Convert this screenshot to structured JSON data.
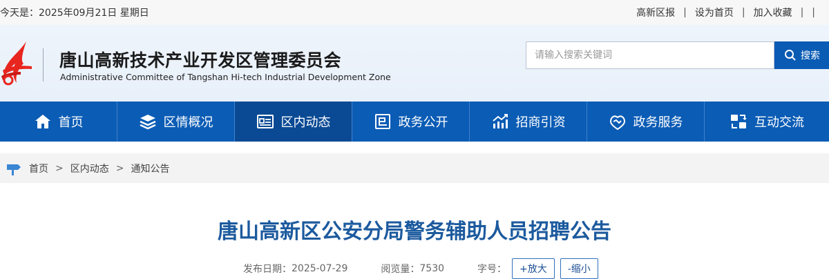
{
  "topbar": {
    "date_label": "今天是：",
    "date_value": "2025年09月21日 星期日",
    "links": [
      "高新区报",
      "设为首页",
      "加入收藏"
    ]
  },
  "header": {
    "title_cn": "唐山高新技术产业开发区管理委员会",
    "title_en": "Administrative Committee of Tangshan Hi-tech Industrial Development Zone",
    "search_placeholder": "请输入搜索关键词",
    "search_button": "搜索",
    "logo_colors": [
      "#e8251e",
      "#f39c12"
    ]
  },
  "nav": {
    "items": [
      {
        "label": "首页",
        "icon": "home-icon"
      },
      {
        "label": "区情概况",
        "icon": "layers-icon"
      },
      {
        "label": "区内动态",
        "icon": "news-icon",
        "active": true
      },
      {
        "label": "政务公开",
        "icon": "document-icon"
      },
      {
        "label": "招商引资",
        "icon": "chart-icon"
      },
      {
        "label": "政务服务",
        "icon": "handshake-icon"
      },
      {
        "label": "互动交流",
        "icon": "exchange-icon"
      }
    ],
    "bg_color": "#0b5cb5",
    "active_color": "#0a4a94"
  },
  "breadcrumb": {
    "items": [
      "首页",
      "区内动态",
      "通知公告"
    ],
    "separator": ">"
  },
  "article": {
    "title": "唐山高新区公安分局警务辅助人员招聘公告",
    "date_label": "发布日期：",
    "date_value": "2025-07-29",
    "views_label": "阅览量：",
    "views_value": "7530",
    "font_label": "字号：",
    "enlarge": "+放大",
    "shrink": "-缩小",
    "title_color": "#1c5a9e"
  }
}
